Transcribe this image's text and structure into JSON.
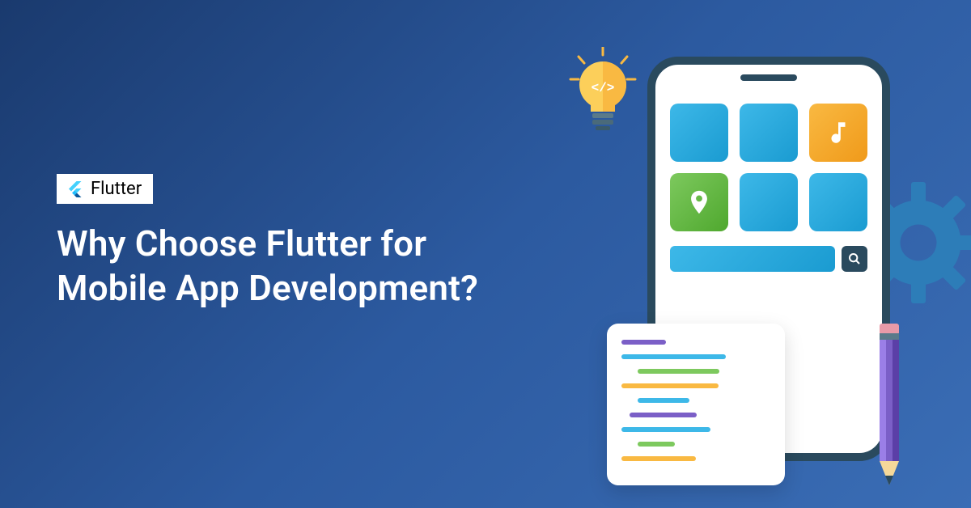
{
  "badge": {
    "label": "Flutter"
  },
  "headline": {
    "line1": "Why Choose Flutter for",
    "line2": "Mobile App Development?"
  },
  "colors": {
    "bg_start": "#1a3a6e",
    "bg_end": "#3a6db5",
    "tile_blue": "#1a9bd1",
    "tile_orange": "#f09a1a",
    "tile_green": "#4fa82e",
    "gear": "#2d7db8",
    "bulb": "#f9b942",
    "pencil_body": "#7b5fc7",
    "phone_frame": "#2a4a5e"
  },
  "icons": {
    "tiles": [
      "blank",
      "blank",
      "music",
      "location",
      "blank",
      "blank"
    ]
  }
}
